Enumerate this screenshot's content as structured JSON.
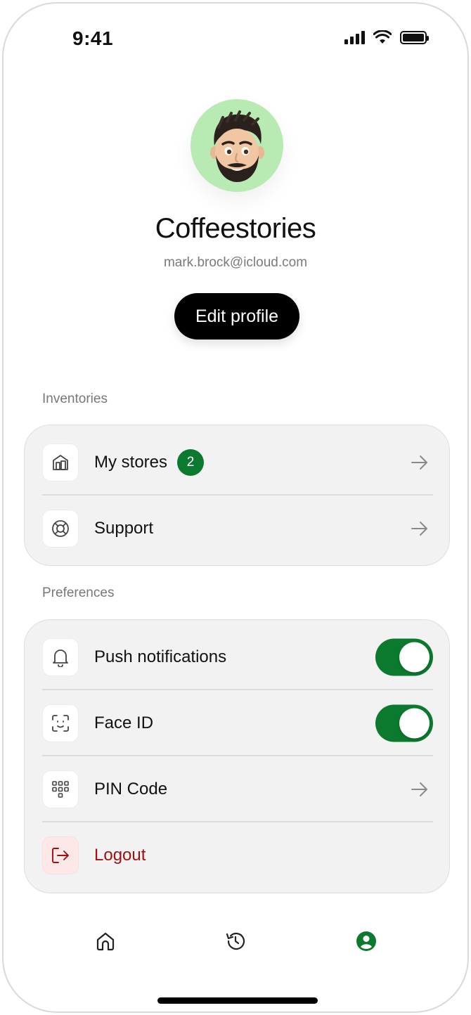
{
  "status_bar": {
    "time": "9:41"
  },
  "profile": {
    "name": "Coffeestories",
    "email": "mark.brock@icloud.com",
    "edit_label": "Edit profile"
  },
  "sections": {
    "inventories": {
      "label": "Inventories",
      "items": [
        {
          "label": "My stores",
          "icon": "store-icon",
          "badge": "2",
          "action": "arrow"
        },
        {
          "label": "Support",
          "icon": "lifebuoy-icon",
          "action": "arrow"
        }
      ]
    },
    "preferences": {
      "label": "Preferences",
      "items": [
        {
          "label": "Push notifications",
          "icon": "bell-icon",
          "action": "toggle",
          "on": true
        },
        {
          "label": "Face ID",
          "icon": "face-id-icon",
          "action": "toggle",
          "on": true
        },
        {
          "label": "PIN Code",
          "icon": "keypad-icon",
          "action": "arrow"
        },
        {
          "label": "Logout",
          "icon": "logout-icon",
          "action": "none"
        }
      ]
    }
  },
  "tabbar": {
    "items": [
      {
        "icon": "home-icon",
        "active": false
      },
      {
        "icon": "history-icon",
        "active": false
      },
      {
        "icon": "profile-icon",
        "active": true
      }
    ]
  },
  "colors": {
    "accent": "#0c7a2e",
    "danger": "#9b1111",
    "avatar_bg": "#b8eab4"
  }
}
